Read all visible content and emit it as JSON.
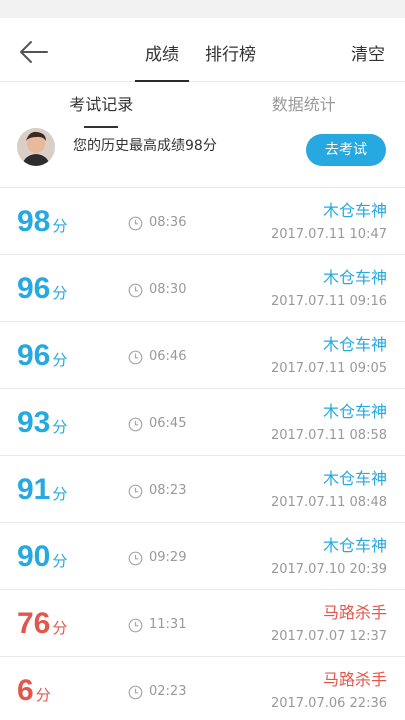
{
  "nav": {
    "tabs": [
      "成绩",
      "排行榜"
    ],
    "clear_label": "清空"
  },
  "subtabs": [
    "考试记录",
    "数据统计"
  ],
  "best": {
    "text": "您的历史最高成绩98分",
    "button_label": "去考试"
  },
  "unit": "分",
  "colors": {
    "accent": "#25a9e0",
    "fail": "#e2574c"
  },
  "records": [
    {
      "score": "98",
      "time": "08:36",
      "grade": "木仓车神",
      "date": "2017.07.11  10:47",
      "color": "blue"
    },
    {
      "score": "96",
      "time": "08:30",
      "grade": "木仓车神",
      "date": "2017.07.11  09:16",
      "color": "blue"
    },
    {
      "score": "96",
      "time": "06:46",
      "grade": "木仓车神",
      "date": "2017.07.11  09:05",
      "color": "blue"
    },
    {
      "score": "93",
      "time": "06:45",
      "grade": "木仓车神",
      "date": "2017.07.11  08:58",
      "color": "blue"
    },
    {
      "score": "91",
      "time": "08:23",
      "grade": "木仓车神",
      "date": "2017.07.11  08:48",
      "color": "blue"
    },
    {
      "score": "90",
      "time": "09:29",
      "grade": "木仓车神",
      "date": "2017.07.10  20:39",
      "color": "blue"
    },
    {
      "score": "76",
      "time": "11:31",
      "grade": "马路杀手",
      "date": "2017.07.07  12:37",
      "color": "red"
    },
    {
      "score": "6",
      "time": "02:23",
      "grade": "马路杀手",
      "date": "2017.07.06  22:36",
      "color": "red"
    }
  ]
}
